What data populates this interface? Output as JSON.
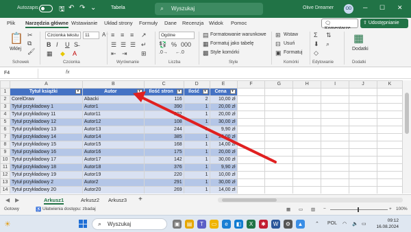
{
  "titlebar": {
    "autosave_label": "Autozapis",
    "document_title": "Tabela",
    "search_placeholder": "Wyszukaj",
    "user_name": "Olive Dreamer",
    "avatar_initials": "OD"
  },
  "tabs": [
    "Plik",
    "Narzędzia główne",
    "Wstawianie",
    "Układ strony",
    "Formuły",
    "Dane",
    "Recenzja",
    "Widok",
    "Pomoc"
  ],
  "active_tab": "Narzędzia główne",
  "buttons": {
    "comments": "Komentarze",
    "share": "Udostępnianie"
  },
  "ribbon": {
    "paste_label": "Wklej",
    "font_name": "Czcionka tekstu",
    "font_size": "11",
    "number_format": "Ogólne",
    "bold": "B",
    "italic": "I",
    "underline": "U",
    "styles": {
      "conditional": "Formatowanie warunkowe",
      "as_table": "Formatuj jako tabelę",
      "cell_styles": "Style komórki"
    },
    "cells": {
      "insert": "Wstaw",
      "delete": "Usuń",
      "format": "Formatuj"
    },
    "addins": "Dodatki",
    "groups": {
      "clipboard": "Schowek",
      "font": "Czcionka",
      "alignment": "Wyrównanie",
      "number": "Liczba",
      "styles": "Style",
      "cells": "Komórki",
      "editing": "Edytowanie",
      "addins": "Dodatki"
    }
  },
  "formula_bar": {
    "name_box": "F4",
    "fx": "fx"
  },
  "sheet": {
    "columns": [
      "A",
      "B",
      "C",
      "D",
      "E",
      "F",
      "G",
      "H",
      "I",
      "J",
      "K"
    ],
    "header": [
      "Tytuł książki",
      "Autor",
      "Ilość stron",
      "Ilość",
      "Cena"
    ],
    "rows": [
      [
        "CorelDraw",
        "Abacki",
        "116",
        "2",
        "10,00 zł"
      ],
      [
        "Tytuł przykładowy 1",
        "Autor1",
        "390",
        "1",
        "20,00 zł"
      ],
      [
        "Tytuł przykładowy 11",
        "Autor11",
        "302",
        "1",
        "20,00 zł"
      ],
      [
        "Tytuł przykładowy 12",
        "Autor12",
        "108",
        "1",
        "30,00 zł"
      ],
      [
        "Tytuł przykładowy 13",
        "Autor13",
        "244",
        "1",
        "9,90 zł"
      ],
      [
        "Tytuł przykładowy 14",
        "Autor14",
        "385",
        "1",
        "20,00 zł"
      ],
      [
        "Tytuł przykładowy 15",
        "Autor15",
        "168",
        "1",
        "14,00 zł"
      ],
      [
        "Tytuł przykładowy 16",
        "Autor16",
        "175",
        "1",
        "20,00 zł"
      ],
      [
        "Tytuł przykładowy 17",
        "Autor17",
        "142",
        "1",
        "30,00 zł"
      ],
      [
        "Tytuł przykładowy 18",
        "Autor18",
        "376",
        "1",
        "9,90 zł"
      ],
      [
        "Tytuł przykładowy 19",
        "Autor19",
        "220",
        "1",
        "10,00 zł"
      ],
      [
        "Tytuł przykładowy 2",
        "Autor2",
        "291",
        "1",
        "30,00 zł"
      ],
      [
        "Tytuł przykładowy 20",
        "Autor20",
        "269",
        "1",
        "14,00 zł"
      ],
      [
        "Tytuł przykładowy 21",
        "Autor21",
        "199",
        "1",
        "20,00 zł"
      ]
    ],
    "filter_button_symbol": "▾"
  },
  "sheet_tabs": [
    "Arkusz1",
    "Arkusz2",
    "Arkusz3"
  ],
  "active_sheet": "Arkusz1",
  "add_sheet": "+",
  "status": {
    "ready": "Gotowy",
    "accessibility": "Ułatwienia dostępu: zbadaj",
    "zoom": "100%"
  },
  "taskbar": {
    "search_placeholder": "Wyszukaj",
    "language": "POL",
    "time": "09:12",
    "date": "16.08.2024"
  },
  "colors": {
    "accent": "#217346",
    "table_header": "#4472c4",
    "band_light": "#d9e1f2",
    "band_dark": "#b4c6e7",
    "annotation_arrow": "#e02020"
  }
}
